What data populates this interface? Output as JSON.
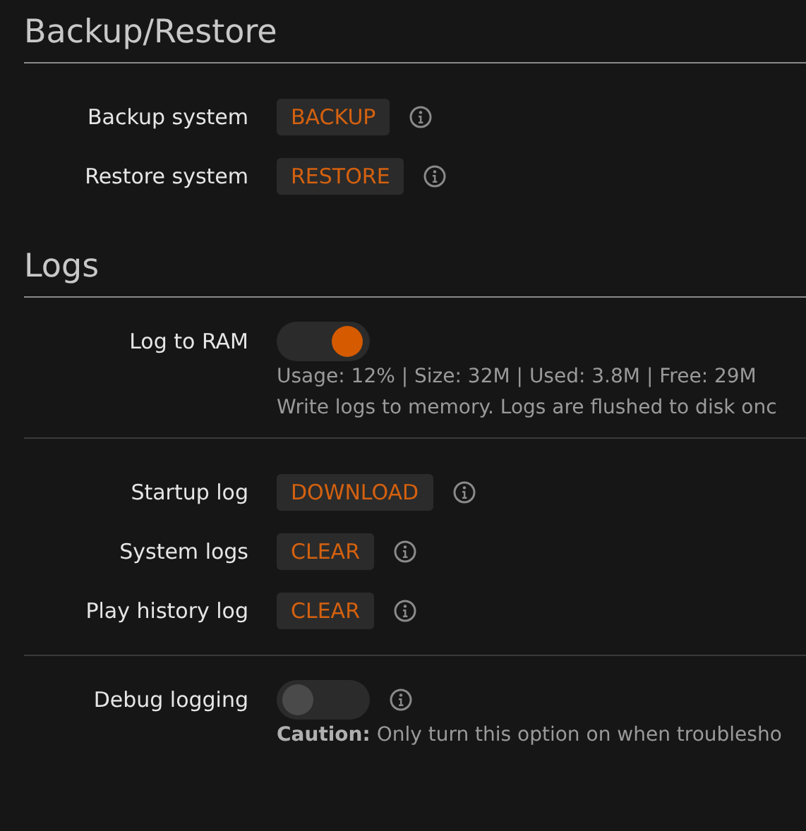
{
  "sections": [
    {
      "title": "Backup/Restore",
      "groups": [
        {
          "rows": [
            {
              "kind": "button",
              "label": "Backup system",
              "button": "BACKUP"
            },
            {
              "kind": "button",
              "label": "Restore system",
              "button": "RESTORE"
            }
          ]
        }
      ]
    },
    {
      "title": "Logs",
      "groups": [
        {
          "rows": [
            {
              "kind": "toggle",
              "label": "Log to RAM",
              "on": true,
              "notes": [
                "Usage: 12% | Size: 32M | Used: 3.8M | Free: 29M",
                "Write logs to memory. Logs are flushed to disk onc"
              ]
            }
          ]
        },
        {
          "rows": [
            {
              "kind": "button",
              "label": "Startup log",
              "button": "DOWNLOAD"
            },
            {
              "kind": "button",
              "label": "System logs",
              "button": "CLEAR"
            },
            {
              "kind": "button",
              "label": "Play history log",
              "button": "CLEAR"
            }
          ]
        },
        {
          "rows": [
            {
              "kind": "toggle",
              "label": "Debug logging",
              "on": false,
              "info": true,
              "notes": [
                "**Caution:** Only turn this option on when troublesho"
              ]
            }
          ]
        }
      ]
    }
  ]
}
